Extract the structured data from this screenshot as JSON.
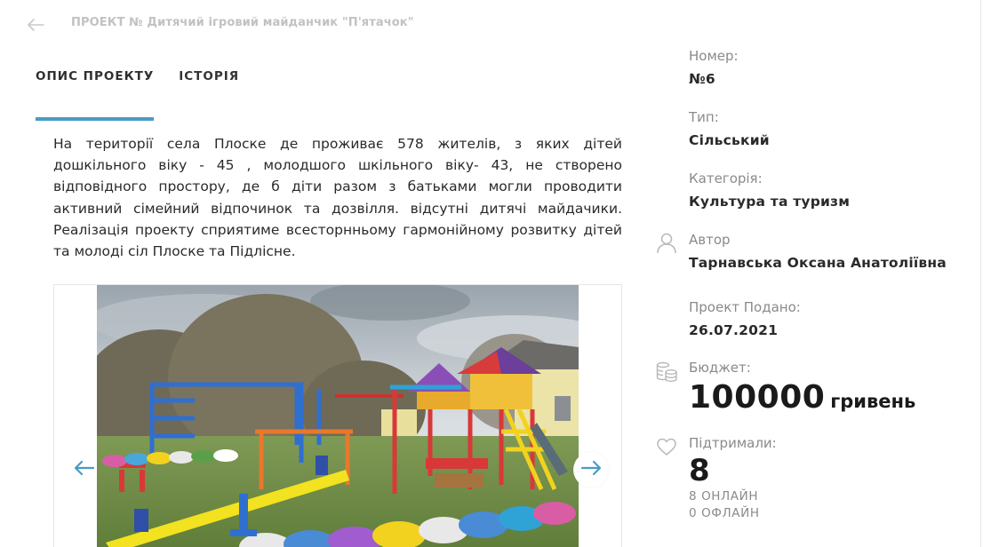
{
  "header": {
    "title": "ПРОЕКТ № Дитячий ігровий майданчик \"П'ятачок\""
  },
  "tabs": [
    {
      "label": "ОПИС ПРОЕКТУ",
      "active": true
    },
    {
      "label": "ІСТОРІЯ",
      "active": false
    }
  ],
  "description": "На території села Плоске де проживає 578 жителів, з яких дітей дошкільного віку - 45 , молодшого шкільного віку- 43, не створено відповідного простору, де б діти разом з батьками могли проводити активний сімейний відпочинок та дозвілля. відсутні дитячі майдачики. Реалізація проекту сприятиме всесторнньому гармонійному розвитку дітей та молоді сіл Плоске та Підлісне.",
  "sidebar": {
    "number": {
      "label": "Номер:",
      "value": "№6"
    },
    "type": {
      "label": "Тип:",
      "value": "Сільський"
    },
    "category": {
      "label": "Категорія:",
      "value": "Культура та туризм"
    },
    "author": {
      "label": "Автор",
      "value": "Тарнавська Оксана Анатоліївна"
    },
    "submitted": {
      "label": "Проект Подано:",
      "value": "26.07.2021"
    },
    "budget": {
      "label": "Бюджет:",
      "amount": "100000",
      "unit": "гривень"
    },
    "support": {
      "label": "Підтримали:",
      "count": "8",
      "online": "8 ОНЛАЙН",
      "offline": "0 ОФЛАЙН"
    }
  },
  "colors": {
    "accent": "#4a9bc4",
    "muted_text": "#8a8a8a",
    "title_text": "#c2c2c2"
  },
  "icons": {
    "back": "arrow-left-icon",
    "author": "user-icon",
    "budget": "coins-icon",
    "support": "heart-icon",
    "gallery_prev": "arrow-left-icon",
    "gallery_next": "arrow-right-icon"
  }
}
